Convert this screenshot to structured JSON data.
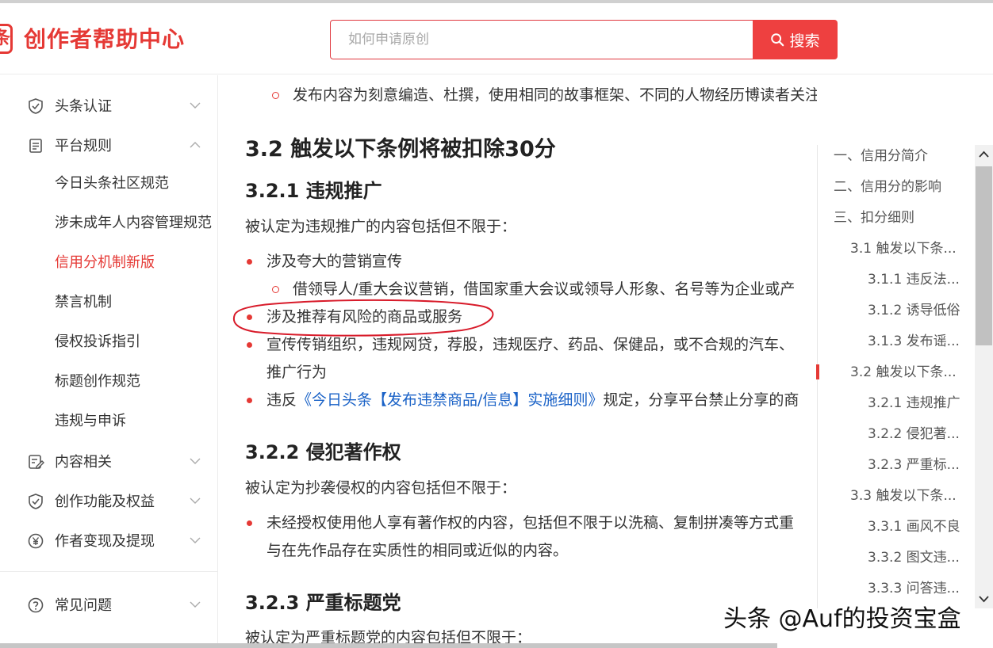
{
  "header": {
    "logo_glyph": "条",
    "brand": "创作者帮助中心",
    "search_placeholder": "如何申请原创",
    "search_button": "搜索",
    "accent": "#ee4040"
  },
  "sidebar": {
    "groups": [
      {
        "label": "头条认证",
        "icon": "shield-check-icon",
        "expanded": false
      },
      {
        "label": "平台规则",
        "icon": "document-icon",
        "expanded": true
      },
      {
        "label": "内容相关",
        "icon": "edit-document-icon",
        "expanded": false
      },
      {
        "label": "创作功能及权益",
        "icon": "shield-check-icon",
        "expanded": false
      },
      {
        "label": "作者变现及提现",
        "icon": "yuan-circle-icon",
        "expanded": false
      },
      {
        "label": "常见问题",
        "icon": "question-circle-icon",
        "expanded": false
      }
    ],
    "rules_items": [
      {
        "label": "今日头条社区规范"
      },
      {
        "label": "涉未成年人内容管理规范"
      },
      {
        "label": "信用分机制新版",
        "active": true
      },
      {
        "label": "禁言机制"
      },
      {
        "label": "侵权投诉指引"
      },
      {
        "label": "标题创作规范"
      },
      {
        "label": "违规与申诉"
      }
    ]
  },
  "article": {
    "top_line": "发布内容为刻意编造、杜撰，使用相同的故事框架、不同的人物经历博读者关注等",
    "section_title": "3.2 触发以下条例将被扣除30分",
    "s321": {
      "title": "3.2.1 违规推广",
      "intro": "被认定为违规推广的内容包括但不限于：",
      "b1": "涉及夸大的营销宣传",
      "b1_sub": "借领导人/重大会议营销，借国家重大会议或领导人形象、名号等为企业或产",
      "b2": "涉及推荐有风险的商品或服务",
      "b3_line1": "宣传传销组织，违规网贷，荐股，违规医疗、药品、保健品，或不合规的汽车、",
      "b3_line2": "推广行为",
      "b4_pre": "违反",
      "b4_link": "《今日头条【发布违禁商品/信息】实施细则》",
      "b4_post": "规定，分享平台禁止分享的商"
    },
    "s322": {
      "title": "3.2.2 侵犯著作权",
      "intro": "被认定为抄袭侵权的内容包括但不限于：",
      "b1_line1": "未经授权使用他人享有著作权的内容，包括但不限于以洗稿、复制拼凑等方式重",
      "b1_line2": "与在先作品存在实质性的相同或近似的内容。"
    },
    "s323": {
      "title": "3.2.3 严重标题党",
      "intro": "被认定为严重标题党的内容包括但不限于："
    }
  },
  "toc": {
    "items": [
      {
        "label": "一、信用分简介",
        "level": 0
      },
      {
        "label": "二、信用分的影响",
        "level": 0
      },
      {
        "label": "三、扣分细则",
        "level": 0
      },
      {
        "label": "3.1 触发以下条...",
        "level": 1
      },
      {
        "label": "3.1.1 违反法...",
        "level": 2
      },
      {
        "label": "3.1.2 诱导低俗",
        "level": 2
      },
      {
        "label": "3.1.3 发布谣...",
        "level": 2
      },
      {
        "label": "3.2 触发以下条...",
        "level": 1,
        "active": true
      },
      {
        "label": "3.2.1 违规推广",
        "level": 2
      },
      {
        "label": "3.2.2 侵犯著...",
        "level": 2
      },
      {
        "label": "3.2.3 严重标...",
        "level": 2
      },
      {
        "label": "3.3 触发以下条...",
        "level": 1
      },
      {
        "label": "3.3.1 画风不良",
        "level": 2
      },
      {
        "label": "3.3.2 图文违...",
        "level": 2
      },
      {
        "label": "3.3.3 问答违...",
        "level": 2
      }
    ]
  },
  "watermark": "头条 @Auf的投资宝盒"
}
